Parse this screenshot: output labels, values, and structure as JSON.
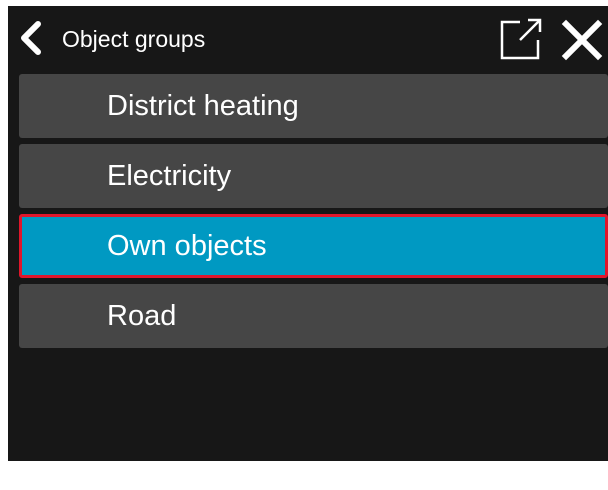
{
  "header": {
    "title": "Object groups",
    "back_icon": "chevron-left-icon",
    "popout_icon": "external-window-icon",
    "close_icon": "close-icon"
  },
  "list": {
    "items": [
      {
        "label": "District heating",
        "selected": false
      },
      {
        "label": "Electricity",
        "selected": false
      },
      {
        "label": "Own objects",
        "selected": true
      },
      {
        "label": "Road",
        "selected": false
      }
    ]
  },
  "colors": {
    "panel_background": "#171717",
    "item_background": "#464646",
    "selected_background": "#0099c2",
    "selected_border": "#e0162b",
    "text": "#ffffff"
  }
}
